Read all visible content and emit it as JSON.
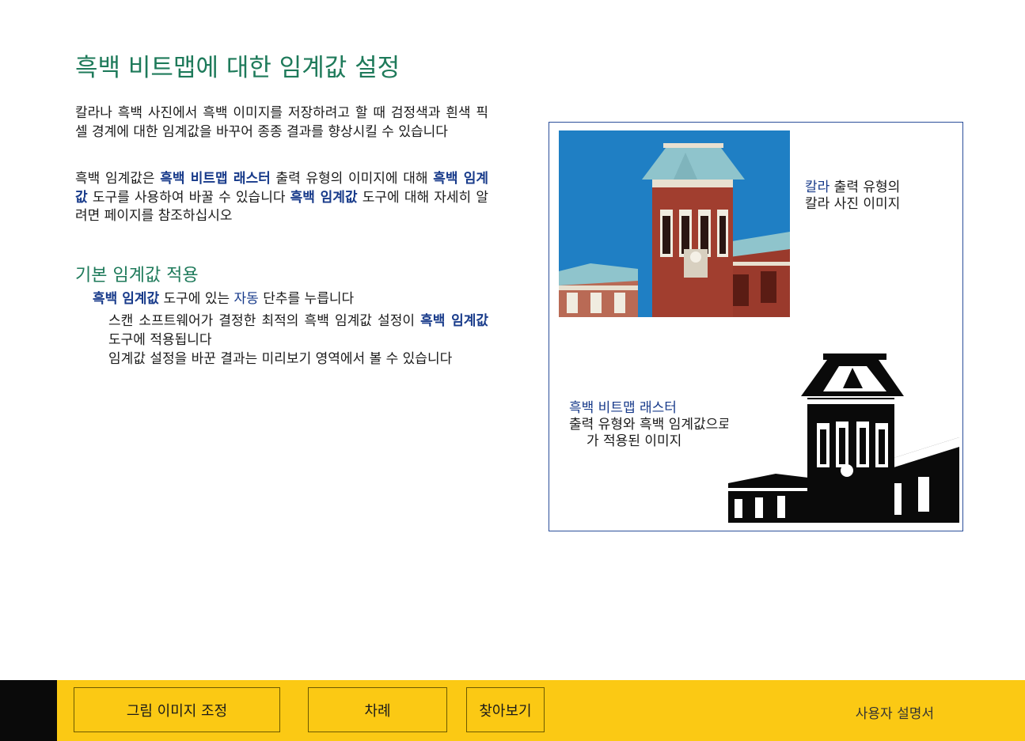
{
  "page": {
    "title": "흑백 비트맵에 대한 임계값 설정",
    "para1": "칼라나 흑백 사진에서 흑백 이미지를 저장하려고 할 때 검정색과 흰색 픽셀 경계에 대한 임계값을 바꾸어 종종 결과를 향상시킬 수 있습니다",
    "para2_a": "흑백 임계값은 ",
    "para2_link1": "흑백 비트맵 래스터",
    "para2_b": " 출력 유형의 이미지에 대해 ",
    "para2_link2": "흑백 임계값",
    "para2_c": " 도구를 사용하여 바꿀 수 있습니다 ",
    "para2_link3": "흑백 임계값",
    "para2_d": " 도구에 대해 자세히 알려면 페이지를 참조하십시오",
    "section_heading": "기본 임계값 적용",
    "step_link": "흑백 임계값",
    "step_mid": " 도구에 있는 ",
    "step_button": "자동",
    "step_end": " 단추를 누릅니다",
    "sub1_a": "스캔 소프트웨어가 결정한 최적의 흑백 임계값 설정이 ",
    "sub1_link": "흑백 임계값",
    "sub1_b": " 도구에 적용됩니다",
    "sub2": "임계값 설정을 바꾼 결과는 미리보기 영역에서 볼 수 있습니다"
  },
  "figure": {
    "caption_color_link": "칼라",
    "caption_color_rest": " 출력 유형의",
    "caption_color_line2": "칼라 사진 이미지",
    "caption_bw_link": "흑백 비트맵 래스터",
    "caption_bw_line2": "출력 유형와 흑백 임계값으로",
    "caption_bw_line3": "가 적용된 이미지",
    "sky_color": "#1f7fc4",
    "brick_color": "#9a3a2c",
    "roof_color": "#8fc4cc"
  },
  "footer": {
    "btn_adjust": "그림 이미지 조정",
    "btn_contents": "차례",
    "btn_index": "찾아보기",
    "manual_label": "사용자 설명서",
    "bar_color": "#fbc914"
  }
}
